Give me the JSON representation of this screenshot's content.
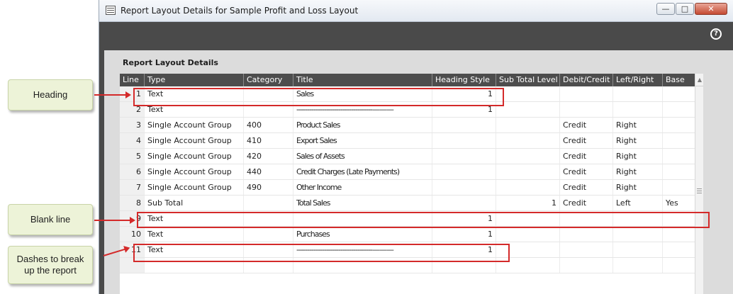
{
  "window": {
    "title": "Report Layout Details for Sample Profit and Loss Layout",
    "minimize": "—",
    "maximize": "□",
    "close": "✕"
  },
  "help_icon": "?",
  "section": {
    "title": "Report Layout Details"
  },
  "grid": {
    "columns": [
      "Line",
      "Type",
      "Category",
      "Title",
      "Heading Style",
      "Sub Total Level",
      "Debit/Credit",
      "Left/Right",
      "Base"
    ],
    "rows": [
      {
        "line": "1",
        "type": "Text",
        "category": "",
        "title": "Sales",
        "heading": "1",
        "sub": "",
        "dc": "",
        "lr": "",
        "base": ""
      },
      {
        "line": "2",
        "type": "Text",
        "category": "",
        "title": "------------------------------------———",
        "heading": "1",
        "sub": "",
        "dc": "",
        "lr": "",
        "base": ""
      },
      {
        "line": "3",
        "type": "Single Account Group",
        "category": "400",
        "title": "Product Sales",
        "heading": "",
        "sub": "",
        "dc": "Credit",
        "lr": "Right",
        "base": ""
      },
      {
        "line": "4",
        "type": "Single Account Group",
        "category": "410",
        "title": "Export Sales",
        "heading": "",
        "sub": "",
        "dc": "Credit",
        "lr": "Right",
        "base": ""
      },
      {
        "line": "5",
        "type": "Single Account Group",
        "category": "420",
        "title": "Sales of Assets",
        "heading": "",
        "sub": "",
        "dc": "Credit",
        "lr": "Right",
        "base": ""
      },
      {
        "line": "6",
        "type": "Single Account Group",
        "category": "440",
        "title": "Credit Charges (Late Payments)",
        "heading": "",
        "sub": "",
        "dc": "Credit",
        "lr": "Right",
        "base": ""
      },
      {
        "line": "7",
        "type": "Single Account Group",
        "category": "490",
        "title": "Other Income",
        "heading": "",
        "sub": "",
        "dc": "Credit",
        "lr": "Right",
        "base": ""
      },
      {
        "line": "8",
        "type": "Sub Total",
        "category": "",
        "title": "Total Sales",
        "heading": "",
        "sub": "1",
        "dc": "Credit",
        "lr": "Left",
        "base": "Yes"
      },
      {
        "line": "9",
        "type": "Text",
        "category": "",
        "title": "",
        "heading": "1",
        "sub": "",
        "dc": "",
        "lr": "",
        "base": ""
      },
      {
        "line": "10",
        "type": "Text",
        "category": "",
        "title": "Purchases",
        "heading": "1",
        "sub": "",
        "dc": "",
        "lr": "",
        "base": ""
      },
      {
        "line": "11",
        "type": "Text",
        "category": "",
        "title": "------------------------------------———",
        "heading": "1",
        "sub": "",
        "dc": "",
        "lr": "",
        "base": ""
      },
      {
        "line": "",
        "type": "",
        "category": "",
        "title": "",
        "heading": "",
        "sub": "",
        "dc": "",
        "lr": "",
        "base": ""
      }
    ]
  },
  "callouts": {
    "heading": "Heading",
    "blank_line": "Blank line",
    "dashes": "Dashes to break up the report"
  },
  "colors": {
    "annotation_red": "#d42a2a",
    "callout_bg": "#edf3d8",
    "header_dark": "#4d4d4d"
  }
}
